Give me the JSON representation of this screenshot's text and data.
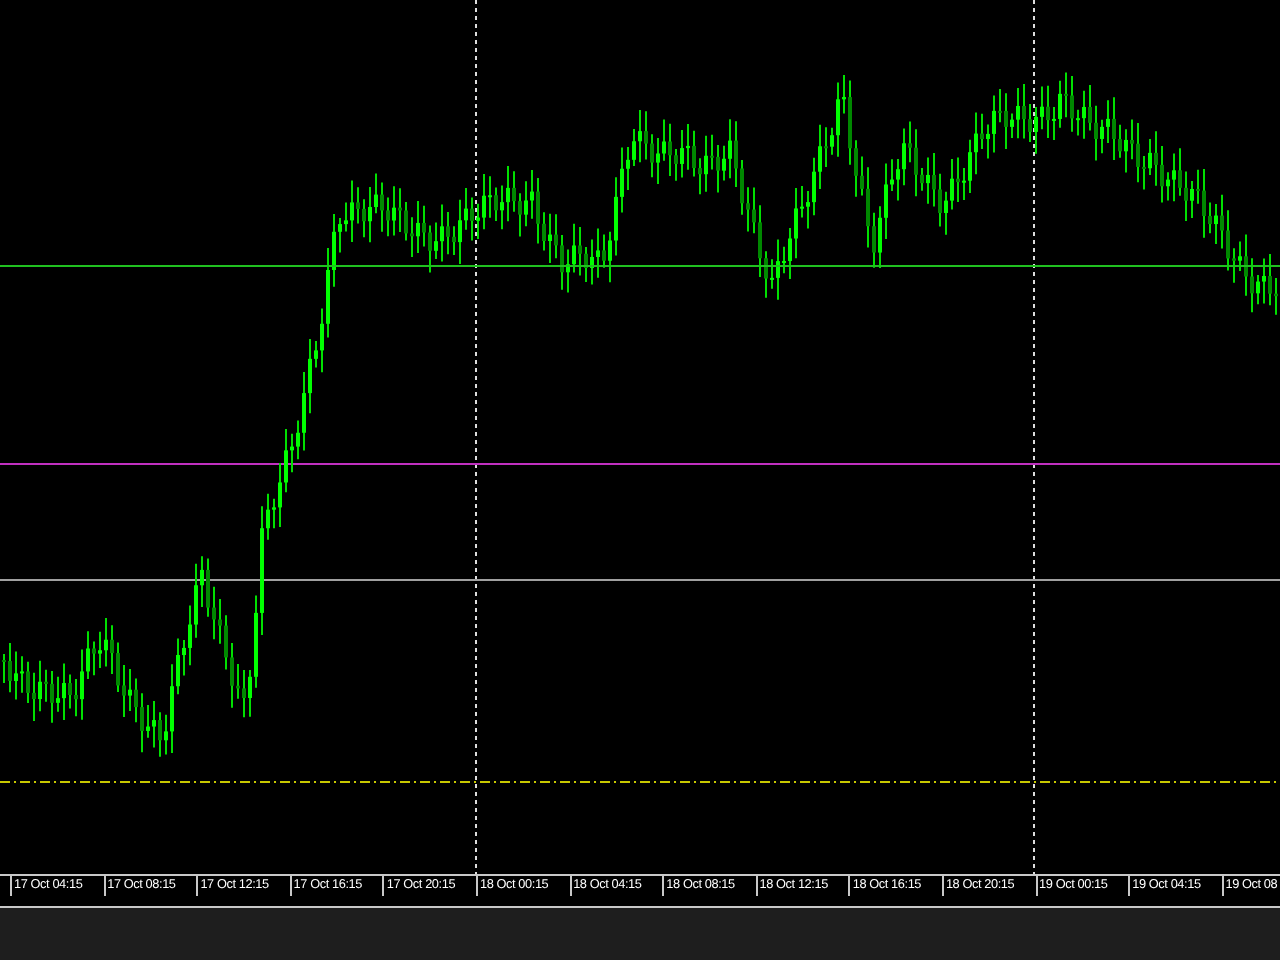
{
  "time_axis": {
    "labels": [
      "17 Oct 04:15",
      "17 Oct 08:15",
      "17 Oct 12:15",
      "17 Oct 16:15",
      "17 Oct 20:15",
      "18 Oct 00:15",
      "18 Oct 04:15",
      "18 Oct 08:15",
      "18 Oct 12:15",
      "18 Oct 16:15",
      "18 Oct 20:15",
      "19 Oct 00:15",
      "19 Oct 04:15",
      "19 Oct 08"
    ]
  }
}
